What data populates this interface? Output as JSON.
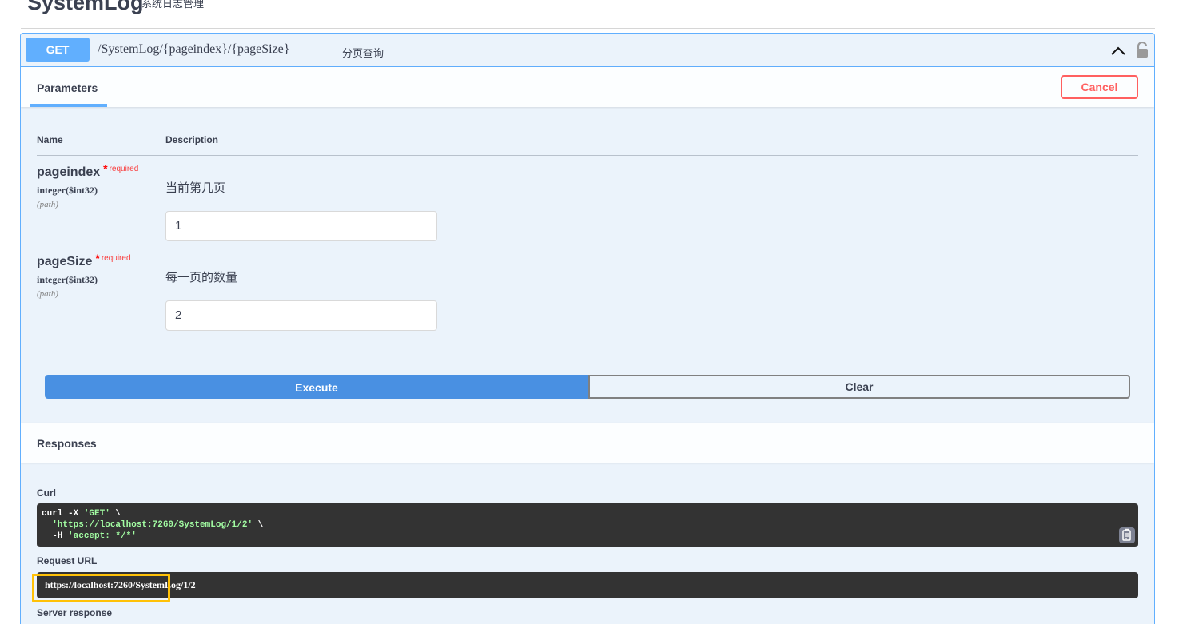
{
  "tag": {
    "title": "SystemLog",
    "description": "系统日志管理"
  },
  "operation": {
    "method": "GET",
    "path": "/SystemLog/{pageindex}/{pageSize}",
    "summary": "分页查询"
  },
  "parameters": {
    "tab_label": "Parameters",
    "cancel_label": "Cancel",
    "col_name": "Name",
    "col_description": "Description",
    "items": [
      {
        "name": "pageindex",
        "required_star": "*",
        "required_label": "required",
        "type": "integer($int32)",
        "in": "(path)",
        "description": "当前第几页",
        "value": "1"
      },
      {
        "name": "pageSize",
        "required_star": "*",
        "required_label": "required",
        "type": "integer($int32)",
        "in": "(path)",
        "description": "每一页的数量",
        "value": "2"
      }
    ],
    "execute_label": "Execute",
    "clear_label": "Clear"
  },
  "responses": {
    "title": "Responses",
    "curl_label": "Curl",
    "curl_lines": [
      {
        "plain": "curl -X ",
        "str": "'GET'",
        "tail": " \\"
      },
      {
        "plain": "  ",
        "str": "'https://localhost:7260/SystemLog/1/2'",
        "tail": " \\"
      },
      {
        "plain": "  -H ",
        "str": "'accept: */*'",
        "tail": ""
      }
    ],
    "request_url_label": "Request URL",
    "request_url": "https://localhost:7260/SystemLog/1/2",
    "server_response_label": "Server response"
  },
  "colors": {
    "get": "#61affe",
    "execute": "#4990e2",
    "cancel": "#ff6060",
    "highlight": "#ffc107"
  }
}
